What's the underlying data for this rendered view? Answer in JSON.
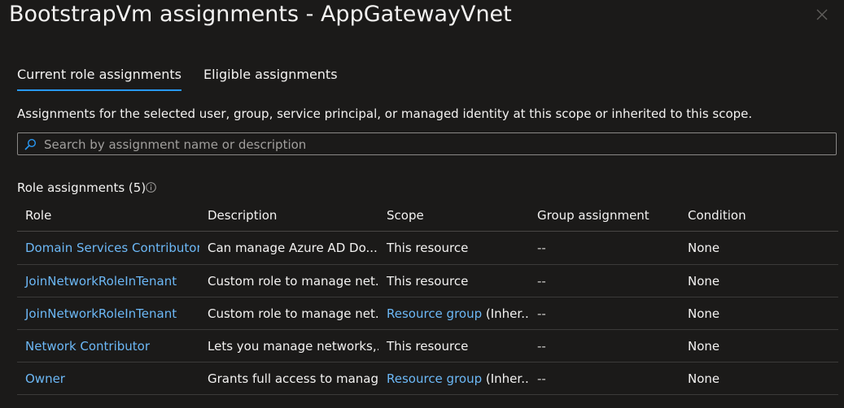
{
  "panel": {
    "title": "BootstrapVm assignments - AppGatewayVnet",
    "close_label": "Close"
  },
  "tabs": [
    {
      "label": "Current role assignments",
      "active": true
    },
    {
      "label": "Eligible assignments",
      "active": false
    }
  ],
  "description": "Assignments for the selected user, group, service principal, or managed identity at this scope or inherited to this scope.",
  "search": {
    "placeholder": "Search by assignment name or description",
    "value": ""
  },
  "role_assignments": {
    "label": "Role assignments (5)",
    "columns": [
      "Role",
      "Description",
      "Scope",
      "Group assignment",
      "Condition"
    ],
    "rows": [
      {
        "role": "Domain Services Contributor",
        "description": "Can manage Azure AD Do...",
        "scope_link": "",
        "scope": "This resource",
        "group": "--",
        "condition": "None"
      },
      {
        "role": "JoinNetworkRoleInTenant",
        "description": "Custom role to manage net...",
        "scope_link": "",
        "scope": "This resource",
        "group": "--",
        "condition": "None"
      },
      {
        "role": "JoinNetworkRoleInTenant",
        "description": "Custom role to manage net...",
        "scope_link": "Resource group",
        "scope": " (Inher...",
        "group": "--",
        "condition": "None"
      },
      {
        "role": "Network Contributor",
        "description": "Lets you manage networks,...",
        "scope_link": "",
        "scope": "This resource",
        "group": "--",
        "condition": "None"
      },
      {
        "role": "Owner",
        "description": "Grants full access to manag...",
        "scope_link": "Resource group",
        "scope": " (Inher...",
        "group": "--",
        "condition": "None"
      }
    ]
  },
  "icons": {
    "close": "close-icon",
    "search": "search-icon",
    "info": "info-icon"
  },
  "colors": {
    "background": "#1b1a19",
    "text": "#f3f2f1",
    "link": "#6cb8f6",
    "accent": "#2899f5"
  }
}
